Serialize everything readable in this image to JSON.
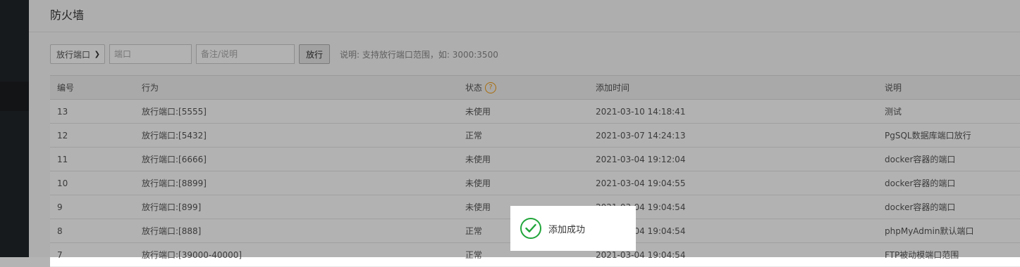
{
  "panel": {
    "title": "防火墙"
  },
  "toolbar": {
    "select_value": "放行端口",
    "port_placeholder": "端口",
    "note_placeholder": "备注/说明",
    "submit_label": "放行",
    "hint": "说明: 支持放行端口范围，如: 3000:3500"
  },
  "table": {
    "headers": {
      "id": "编号",
      "action": "行为",
      "status": "状态",
      "time": "添加时间",
      "note": "说明"
    },
    "rows": [
      {
        "id": "13",
        "action": "放行端口:[5555]",
        "status": "未使用",
        "time": "2021-03-10 14:18:41",
        "note": "测试"
      },
      {
        "id": "12",
        "action": "放行端口:[5432]",
        "status": "正常",
        "time": "2021-03-07 14:24:13",
        "note": "PgSQL数据库端口放行"
      },
      {
        "id": "11",
        "action": "放行端口:[6666]",
        "status": "未使用",
        "time": "2021-03-04 19:12:04",
        "note": "docker容器的端口"
      },
      {
        "id": "10",
        "action": "放行端口:[8899]",
        "status": "未使用",
        "time": "2021-03-04 19:04:55",
        "note": "docker容器的端口"
      },
      {
        "id": "9",
        "action": "放行端口:[899]",
        "status": "未使用",
        "time": "2021-03-04 19:04:54",
        "note": "docker容器的端口"
      },
      {
        "id": "8",
        "action": "放行端口:[888]",
        "status": "正常",
        "time": "2021-03-04 19:04:54",
        "note": "phpMyAdmin默认端口"
      },
      {
        "id": "7",
        "action": "放行端口:[39000-40000]",
        "status": "正常",
        "time": "2021-03-04 19:04:54",
        "note": "FTP被动模端口范围"
      }
    ]
  },
  "toast": {
    "message": "添加成功",
    "icon": "check-circle-icon",
    "color": "#20a53a"
  }
}
